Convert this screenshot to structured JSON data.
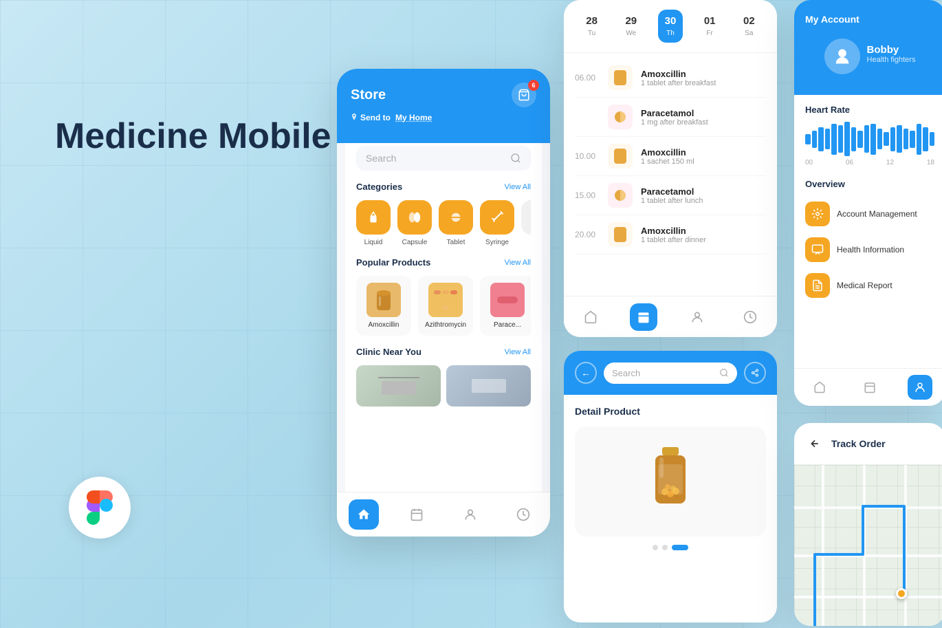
{
  "app": {
    "title": "Medicine Mobile App",
    "background": "light-blue-gradient"
  },
  "store_screen": {
    "title": "Store",
    "location_prefix": "Send to",
    "location": "My Home",
    "cart_badge": "6",
    "search_placeholder": "Search",
    "categories_label": "Categories",
    "categories_view_all": "View All",
    "categories": [
      {
        "label": "Liquid",
        "icon": "💊"
      },
      {
        "label": "Capsule",
        "icon": "💊"
      },
      {
        "label": "Tablet",
        "icon": "💊"
      },
      {
        "label": "Syringe",
        "icon": "💉"
      }
    ],
    "popular_label": "Popular Products",
    "popular_view_all": "View All",
    "products": [
      {
        "name": "Amoxcillin"
      },
      {
        "name": "Azithtromycin"
      },
      {
        "name": "Parace..."
      }
    ],
    "clinic_label": "Clinic Near You",
    "clinic_view_all": "View All"
  },
  "schedule_screen": {
    "days": [
      {
        "num": "28",
        "name": "Tu"
      },
      {
        "num": "29",
        "name": "We"
      },
      {
        "num": "30",
        "name": "Th",
        "active": true
      },
      {
        "num": "01",
        "name": "Fr"
      },
      {
        "num": "02",
        "name": "Sa"
      }
    ],
    "entries": [
      {
        "time": "06.00",
        "name": "Amoxcillin",
        "dose": "1 tablet after breakfast",
        "type": "pill"
      },
      {
        "time": "",
        "name": "Paracetamol",
        "dose": "1 mg after breakfast",
        "type": "capsule"
      },
      {
        "time": "10.00",
        "name": "Amoxcillin",
        "dose": "1 sachet 150 ml",
        "type": "pill"
      },
      {
        "time": "15.00",
        "name": "Paracetamol",
        "dose": "1 tablet after lunch",
        "type": "capsule"
      },
      {
        "time": "20.00",
        "name": "Amoxcillin",
        "dose": "1 tablet after dinner",
        "type": "pill"
      }
    ]
  },
  "detail_screen": {
    "search_placeholder": "Search",
    "title": "Detail Product"
  },
  "account_screen": {
    "title": "My Account",
    "user_name": "Bobby",
    "user_team": "Health fighters",
    "heart_rate_label": "Heart Rate",
    "chart_labels": [
      "00",
      "06",
      "12",
      "18"
    ],
    "chart_bars": [
      3,
      5,
      7,
      6,
      9,
      8,
      10,
      7,
      5,
      8,
      9,
      6,
      4,
      7,
      8,
      6,
      5,
      9,
      7,
      4
    ],
    "overview_label": "Overview",
    "overview_items": [
      {
        "label": "Account Management",
        "icon": "⚙️"
      },
      {
        "label": "Health Information",
        "icon": "📊"
      },
      {
        "label": "Medical Report",
        "icon": "📋"
      }
    ]
  },
  "track_screen": {
    "title": "Track Order"
  }
}
